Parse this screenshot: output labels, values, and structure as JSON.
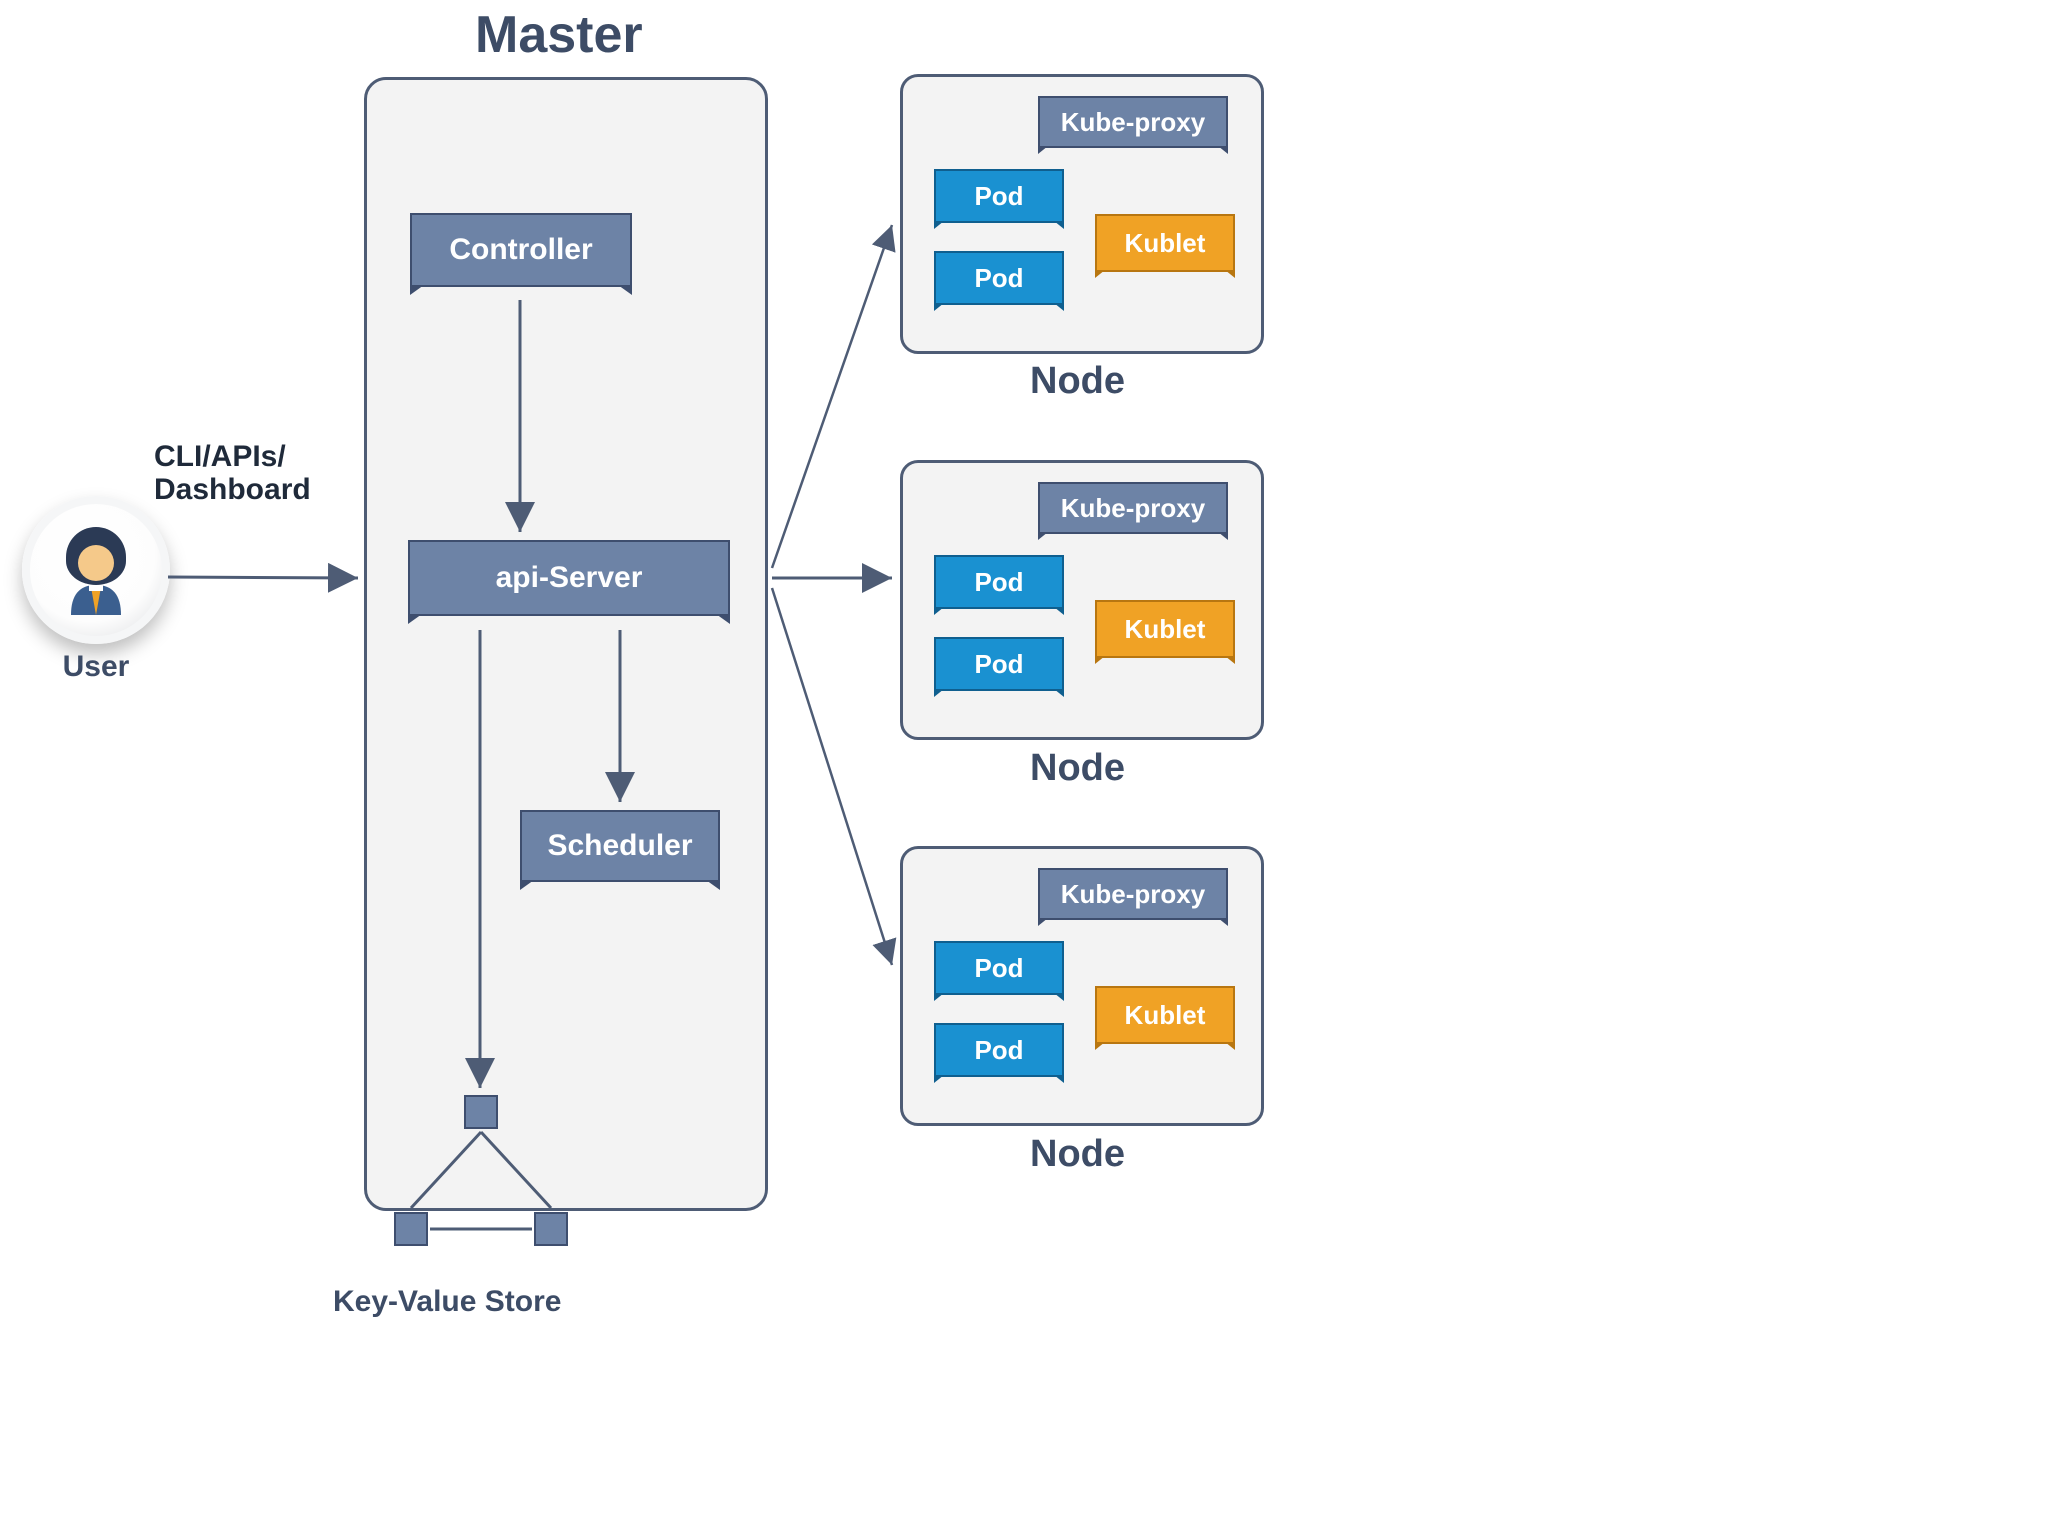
{
  "titles": {
    "master": "Master",
    "user": "User",
    "kv_store": "Key-Value Store",
    "conn_line1": "CLI/APIs/",
    "conn_line2": "Dashboard"
  },
  "master": {
    "controller": "Controller",
    "api_server": "api-Server",
    "scheduler": "Scheduler"
  },
  "node": {
    "label": "Node",
    "kube_proxy": "Kube-proxy",
    "pod": "Pod",
    "kublet": "Kublet"
  },
  "colors": {
    "slate": "#6d83a6",
    "blue": "#1a91d1",
    "orange": "#f0a225",
    "text": "#3d4c66"
  }
}
